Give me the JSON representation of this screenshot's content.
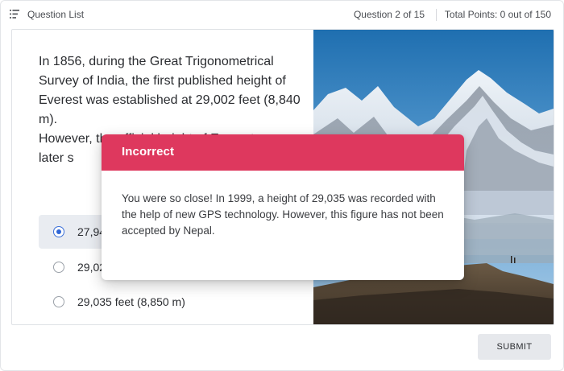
{
  "header": {
    "question_list_label": "Question List",
    "question_count": "Question 2 of 15",
    "total_points": "Total Points: 0 out of 150"
  },
  "question": {
    "paragraph_1": "In 1856, during the Great Trigonometrical Survey of India, the first published height of Everest was established at 29,002 feet (8,840 m).",
    "paragraph_2": "However, the official height of Everest was later s"
  },
  "answers": [
    {
      "label": "27,94",
      "selected": true
    },
    {
      "label": "29,02",
      "selected": false
    },
    {
      "label": "29,035 feet (8,850 m)",
      "selected": false
    }
  ],
  "feedback": {
    "title": "Incorrect",
    "message": "You were so close! In 1999, a height of 29,035 was recorded with the help of new GPS technology. However, this figure has not been accepted by Nepal."
  },
  "submit_label": "SUBMIT",
  "colors": {
    "incorrect_header": "#de385e",
    "radio_selected": "#2f66d6",
    "selected_row_bg": "#e9ecf1"
  }
}
